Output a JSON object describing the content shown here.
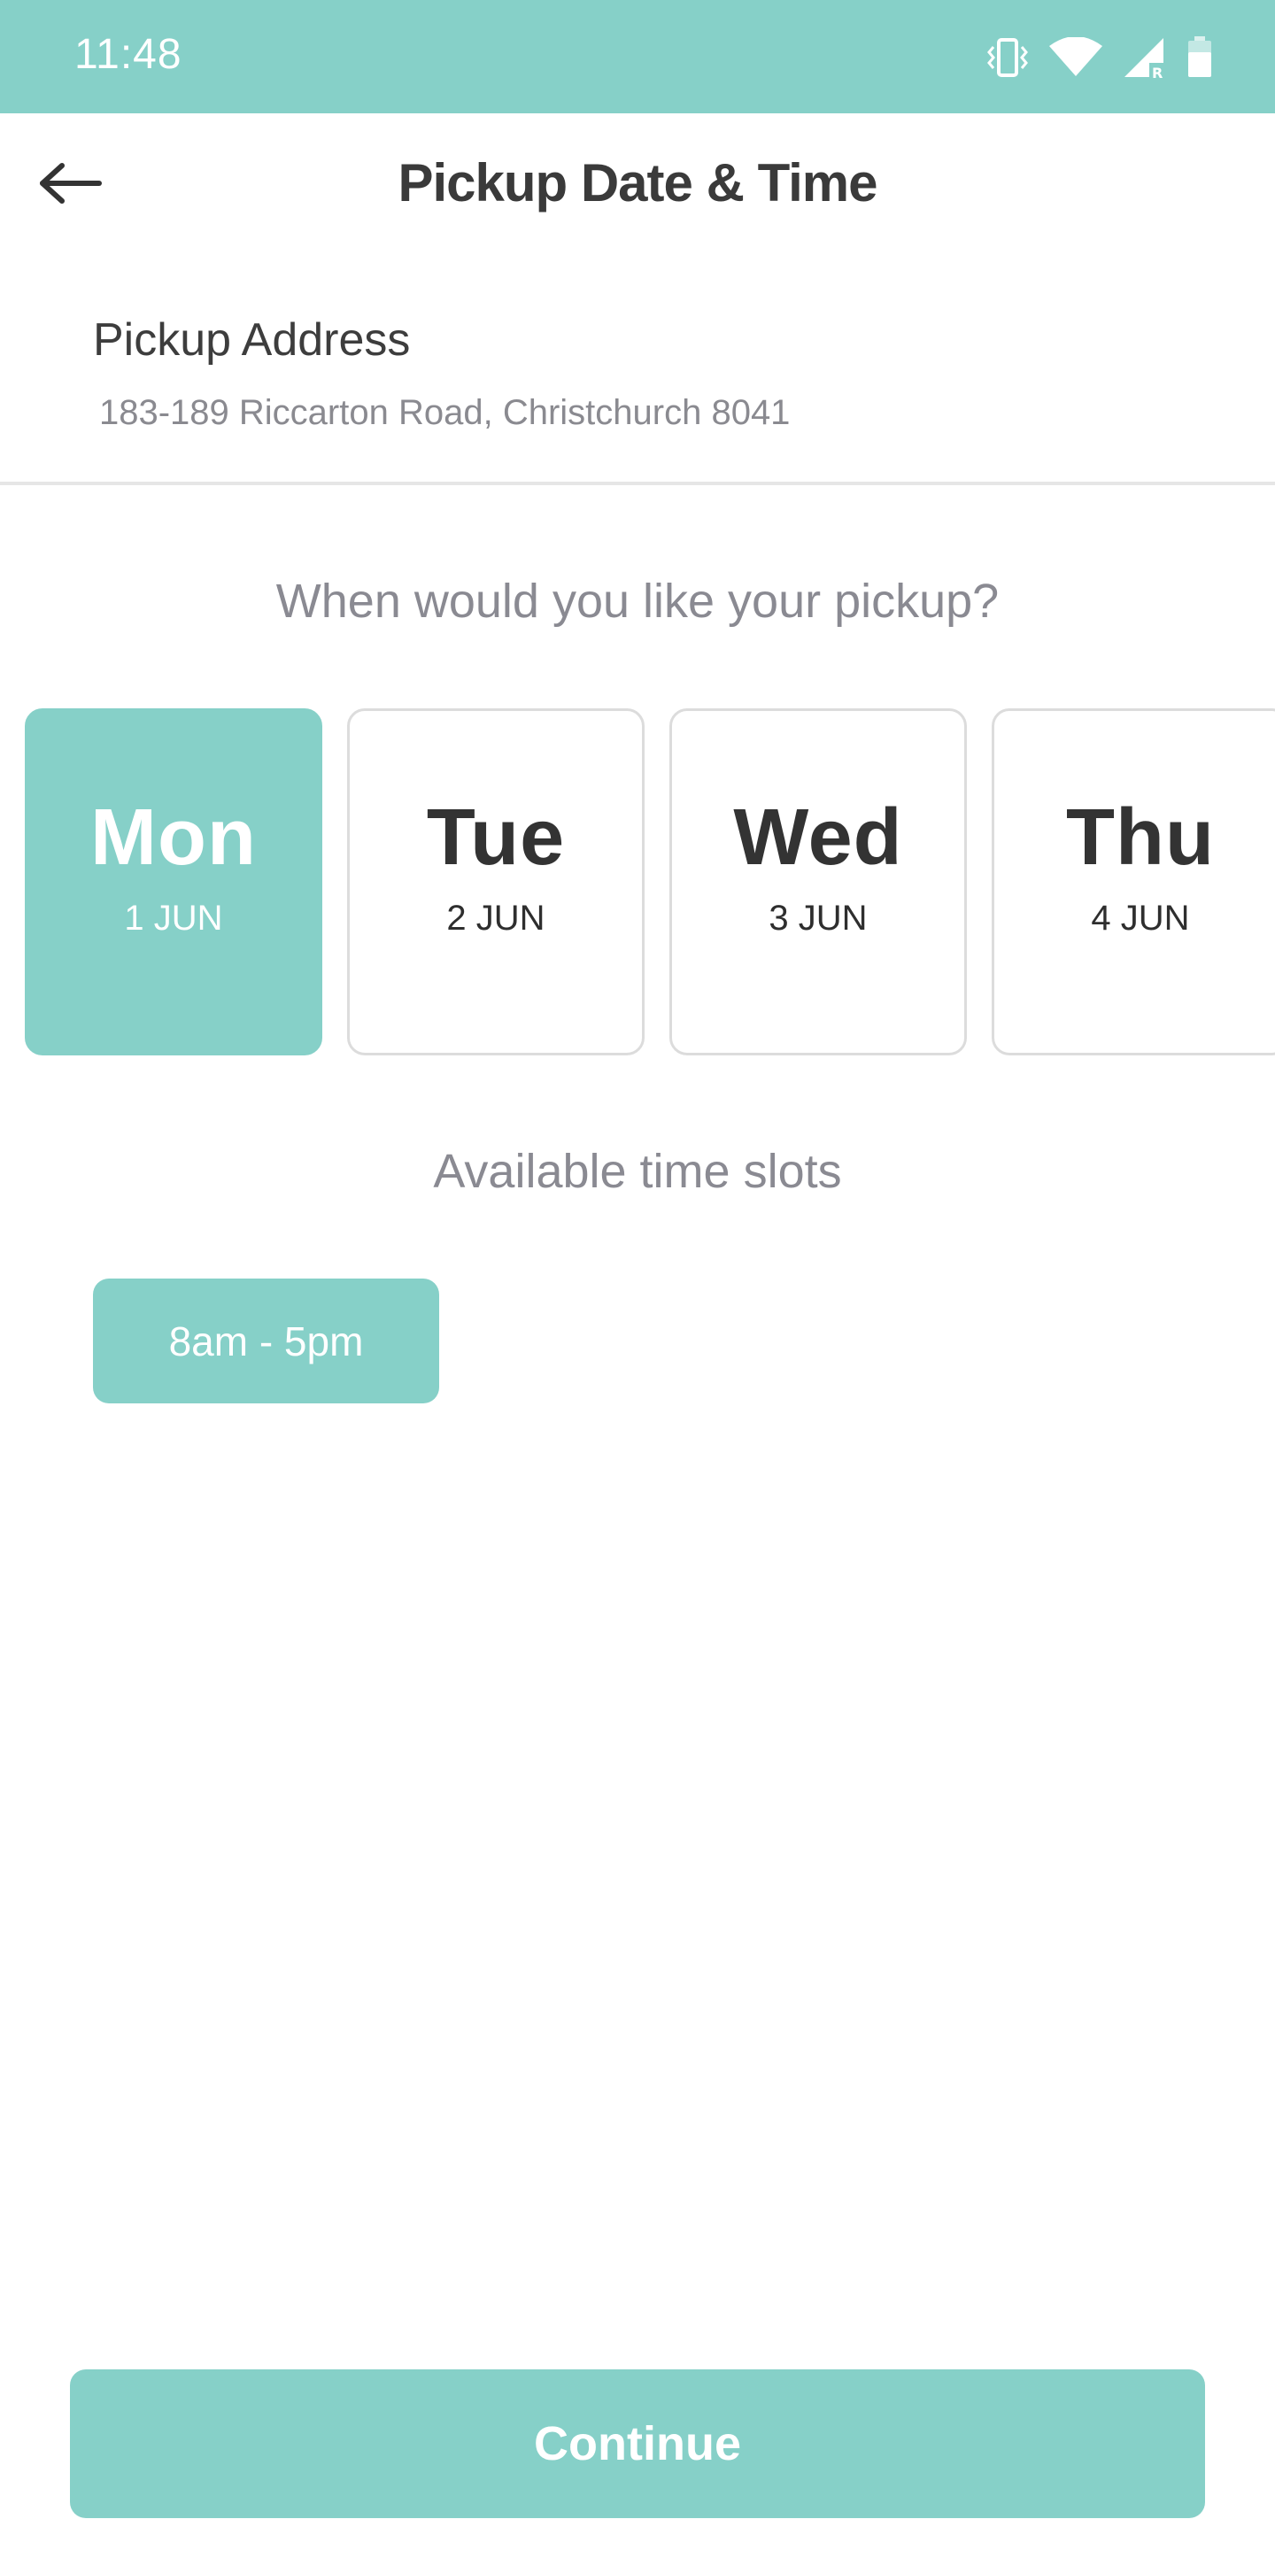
{
  "status_bar": {
    "time": "11:48",
    "icons": [
      "vibrate-icon",
      "wifi-icon",
      "signal-roaming-icon",
      "battery-icon"
    ],
    "background_color": "#86d0c8"
  },
  "header": {
    "back_icon": "arrow-left-icon",
    "title": "Pickup Date & Time"
  },
  "address": {
    "label": "Pickup Address",
    "value": "183-189 Riccarton Road, Christchurch 8041"
  },
  "date_picker": {
    "question": "When would you like your pickup?",
    "days": [
      {
        "day": "Mon",
        "date": "1 JUN",
        "selected": true
      },
      {
        "day": "Tue",
        "date": "2 JUN",
        "selected": false
      },
      {
        "day": "Wed",
        "date": "3 JUN",
        "selected": false
      },
      {
        "day": "Thu",
        "date": "4 JUN",
        "selected": false
      }
    ]
  },
  "time_slots": {
    "heading": "Available time slots",
    "slots": [
      {
        "label": "8am - 5pm"
      }
    ]
  },
  "footer": {
    "continue_label": "Continue"
  },
  "colors": {
    "accent": "#86d0c8",
    "text_dark": "#333333",
    "text_muted": "#8a8a92",
    "border": "#dcdcdc"
  }
}
